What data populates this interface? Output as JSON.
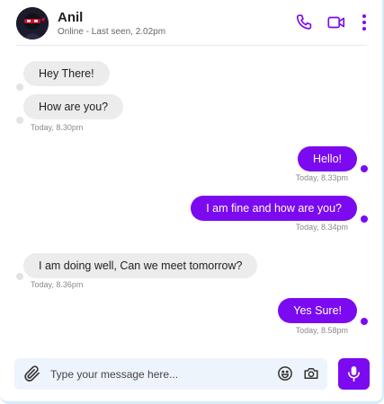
{
  "header": {
    "name": "Anil",
    "status": "Online - Last seen, 2.02pm",
    "avatar_icon": "ninja-avatar",
    "icons": [
      "phone-icon",
      "video-call-icon",
      "more-vertical-icon"
    ]
  },
  "messages": [
    {
      "direction": "incoming",
      "text": "Hey There!"
    },
    {
      "direction": "incoming",
      "text": "How are you?",
      "time": "Today, 8.30pm"
    },
    {
      "direction": "outgoing",
      "text": "Hello!",
      "time": "Today, 8.33pm"
    },
    {
      "direction": "outgoing",
      "text": "I am fine and how are you?",
      "time": "Today, 8.34pm"
    },
    {
      "direction": "incoming",
      "text": "I am doing well, Can we meet tomorrow?",
      "time": "Today, 8.36pm"
    },
    {
      "direction": "outgoing",
      "text": "Yes Sure!",
      "time": "Today, 8.58pm"
    }
  ],
  "composer": {
    "placeholder": "Type your message here...",
    "icons": [
      "paperclip-icon",
      "emoji-icon",
      "camera-icon",
      "microphone-icon"
    ]
  },
  "colors": {
    "accent": "#7b0af0",
    "incoming_bubble": "#ececec",
    "input_bg": "#eef4fc"
  }
}
